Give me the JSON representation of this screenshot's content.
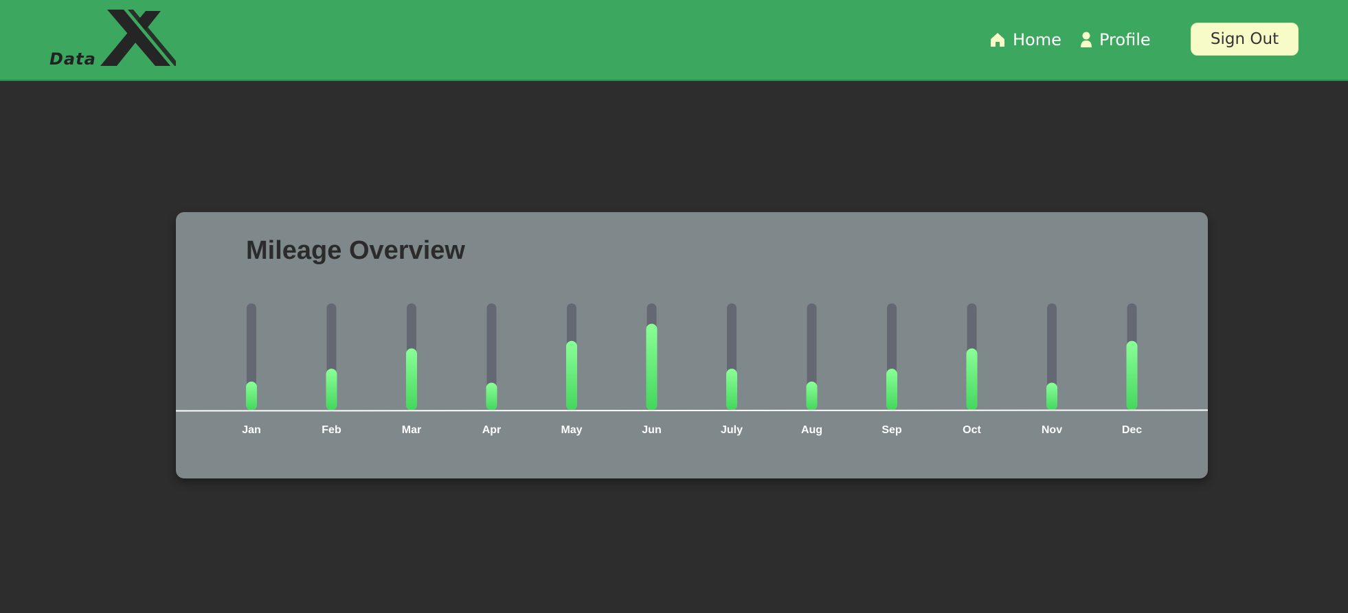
{
  "header": {
    "logo_text": "Data",
    "nav": {
      "home_label": "Home",
      "profile_label": "Profile"
    },
    "sign_out_label": "Sign Out",
    "colors": {
      "bar_bg": "#3ca75e",
      "button_bg": "#f7fbc8"
    },
    "icons": {
      "home": "home-icon",
      "profile": "user-icon",
      "logo": "x-logo-icon"
    }
  },
  "card": {
    "title": "Mileage Overview"
  },
  "chart_data": {
    "type": "bar",
    "categories": [
      "Jan",
      "Feb",
      "Mar",
      "Apr",
      "May",
      "Jun",
      "July",
      "Aug",
      "Sep",
      "Oct",
      "Nov",
      "Dec"
    ],
    "values": [
      0.27,
      0.39,
      0.58,
      0.26,
      0.65,
      0.81,
      0.39,
      0.27,
      0.39,
      0.58,
      0.26,
      0.65
    ],
    "ylim": [
      0,
      1
    ],
    "colors": {
      "track": "#646873",
      "fill_top": "#8bff98",
      "fill_bottom": "#44d65d",
      "baseline": "#ffffff"
    }
  }
}
